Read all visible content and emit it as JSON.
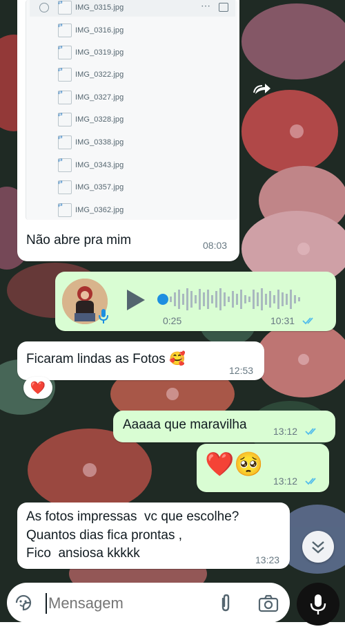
{
  "attachment_list": {
    "files": [
      "IMG_0315.jpg",
      "IMG_0316.jpg",
      "IMG_0319.jpg",
      "IMG_0322.jpg",
      "IMG_0327.jpg",
      "IMG_0328.jpg",
      "IMG_0338.jpg",
      "IMG_0343.jpg",
      "IMG_0357.jpg",
      "IMG_0362.jpg"
    ],
    "icons": [
      "radio-unchecked-icon",
      "more-dots-icon",
      "share-icon",
      "image-file-icon"
    ]
  },
  "messages": {
    "m1": {
      "text": "Não abre pra mim",
      "time": "08:03"
    },
    "voice": {
      "duration": "0:25",
      "time": "10:31",
      "status": "read"
    },
    "m2": {
      "text": "Ficaram lindas as Fotos 🥰",
      "time": "12:53",
      "reaction": "❤️"
    },
    "m3": {
      "text": "Aaaaa que maravilha",
      "time": "13:12",
      "status": "read"
    },
    "m4": {
      "text": "❤️🥺",
      "time": "13:12",
      "status": "read"
    },
    "m5": {
      "line1": "As fotos impressas  vc que escolhe?",
      "line2": "Quantos dias fica prontas ,",
      "line3": "Fico  ansiosa kkkkk",
      "time": "13:23"
    }
  },
  "composer": {
    "placeholder": "Mensagem"
  },
  "colors": {
    "outgoing": "#d9fdd3",
    "incoming": "#ffffff",
    "read_tick": "#53bdeb",
    "mic_button": "#111111"
  }
}
